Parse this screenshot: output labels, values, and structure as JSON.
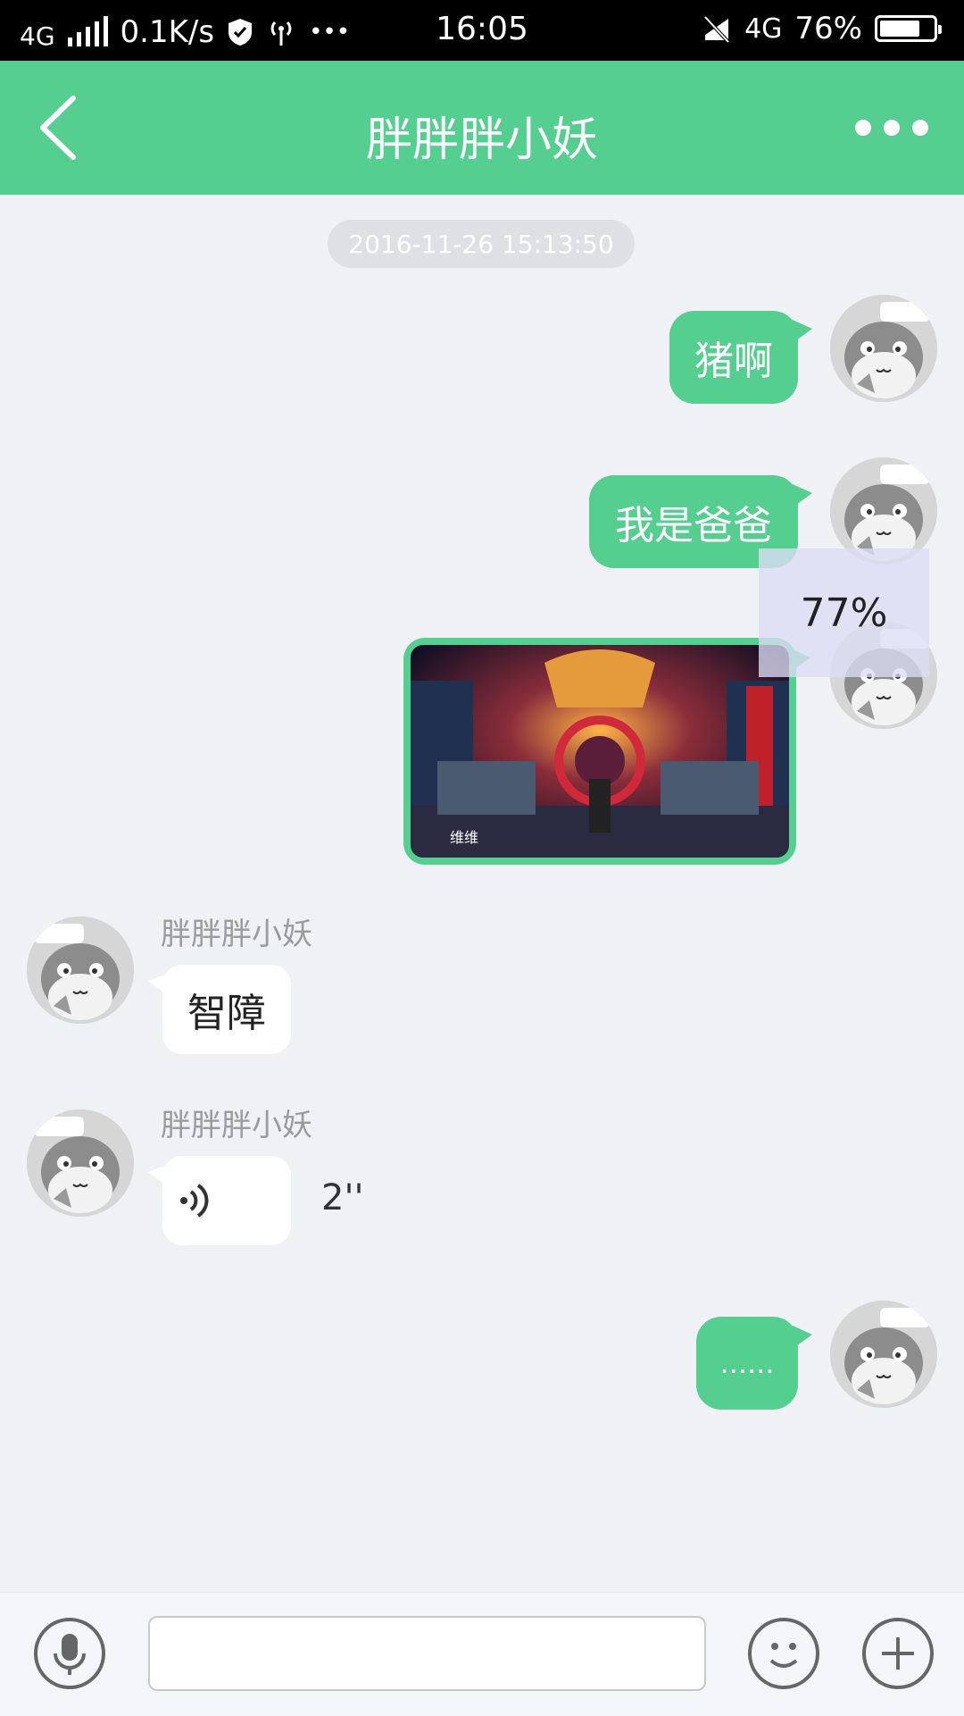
{
  "status_bar": {
    "network_label": "4G",
    "speed": "0.1K/s",
    "more_dots": "•••",
    "time": "16:05",
    "network_right": "4G",
    "battery": "76%",
    "battery_level": 0.76
  },
  "header": {
    "back_icon": "chevron-left-icon",
    "title": "胖胖胖小妖",
    "more_icon": "more-dots-icon"
  },
  "chat": {
    "timestamp": "2016-11-26 15:13:50",
    "messages": [
      {
        "side": "right",
        "type": "text",
        "text": "猪啊"
      },
      {
        "side": "right",
        "type": "text",
        "text": "我是爸爸"
      },
      {
        "side": "right",
        "type": "image",
        "caption": "维维",
        "upload_progress": "77%"
      },
      {
        "side": "left",
        "type": "text",
        "sender": "胖胖胖小妖",
        "text": "智障"
      },
      {
        "side": "left",
        "type": "voice",
        "sender": "胖胖胖小妖",
        "duration": "2''"
      },
      {
        "side": "right",
        "type": "text",
        "text": "......"
      }
    ]
  },
  "input_bar": {
    "voice_icon": "microphone-icon",
    "text_value": "",
    "emoji_icon": "smiley-icon",
    "plus_icon": "plus-icon"
  },
  "colors": {
    "accent": "#55cf8f",
    "background": "#f0f1f5",
    "status_bar": "#000000"
  }
}
